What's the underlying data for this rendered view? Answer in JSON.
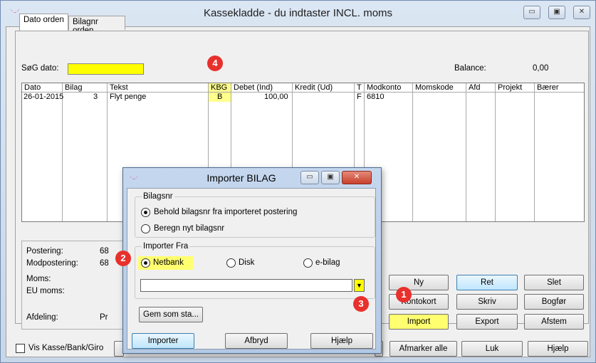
{
  "window": {
    "title": "Kassekladde - du indtaster INCL. moms",
    "controls": [
      "▭",
      "▣",
      "✕"
    ]
  },
  "tabs": [
    {
      "label": "Dato orden",
      "active": true
    },
    {
      "label": "Bilagnr orden",
      "active": false
    }
  ],
  "search": {
    "label": "SøG dato:",
    "value": ""
  },
  "balance": {
    "label": "Balance:",
    "value": "0,00"
  },
  "annotations": {
    "b1": "1",
    "b2": "2",
    "b3": "3",
    "b4": "4"
  },
  "grid": {
    "columns": [
      "Dato",
      "Bilag",
      "Tekst",
      "KBG",
      "Debet (Ind)",
      "Kredit (Ud)",
      "T",
      "Modkonto",
      "Momskode",
      "Afd",
      "Projekt",
      "Bærer"
    ],
    "rows": [
      {
        "dato": "26-01-2015",
        "bilag": "3",
        "tekst": "Flyt penge",
        "kbg": "B",
        "debet": "100,00",
        "kredit": "",
        "t": "F",
        "modkonto": "6810",
        "momskode": "",
        "afd": "",
        "projekt": "",
        "baerer": ""
      }
    ]
  },
  "info": {
    "postering_label": "Postering:",
    "postering_value": "68",
    "modpostering_label": "Modpostering:",
    "modpostering_value": "68",
    "moms_label": "Moms:",
    "eu_moms_label": "EU moms:",
    "afdeling_label": "Afdeling:",
    "afdeling_value": "Pr"
  },
  "buttons": {
    "ny": "Ny",
    "ret": "Ret",
    "slet": "Slet",
    "kontokort": "Kontokort",
    "skriv": "Skriv",
    "bogfor": "Bogfør",
    "import": "Import",
    "export": "Export",
    "afstem": "Afstem",
    "afmarker_alle": "Afmarker alle",
    "luk": "Luk",
    "hjaelp": "Hjælp"
  },
  "bottom": {
    "vis_kasse": "Vis Kasse/Bank/Giro"
  },
  "dialog": {
    "title": "Importer BILAG",
    "bilagsnr_legend": "Bilagsnr",
    "behold": "Behold bilagsnr fra importeret postering",
    "beregn": "Beregn nyt bilagsnr",
    "importer_fra_legend": "Importer Fra",
    "netbank": "Netbank",
    "disk": "Disk",
    "ebilag": "e-bilag",
    "path_value": "",
    "gem_som": "Gem som sta...",
    "importer": "Importer",
    "afbryd": "Afbryd",
    "hjaelp": "Hjælp"
  },
  "colors": {
    "highlight": "#ffff00",
    "badge": "#e8302c"
  }
}
